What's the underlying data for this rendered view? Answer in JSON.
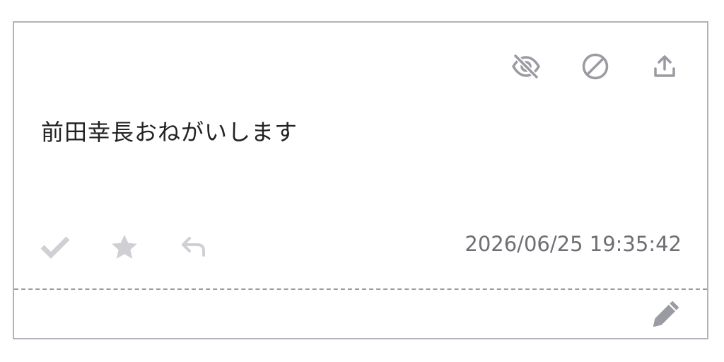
{
  "message": {
    "text": "前田幸長おねがいします",
    "timestamp": "2026/06/25 19:35:42"
  },
  "icons": {
    "hide": "eye-slash-icon",
    "block": "prohibited-icon",
    "share": "upload-icon",
    "check": "checkmark-icon",
    "favorite": "star-icon",
    "reply": "reply-icon",
    "edit": "pencil-icon"
  },
  "colors": {
    "border": "#b2b2bc",
    "icon_top": "#9a9aa2",
    "icon_muted": "#d0d0d4",
    "text": "#222222",
    "timestamp": "#6e6e74"
  }
}
